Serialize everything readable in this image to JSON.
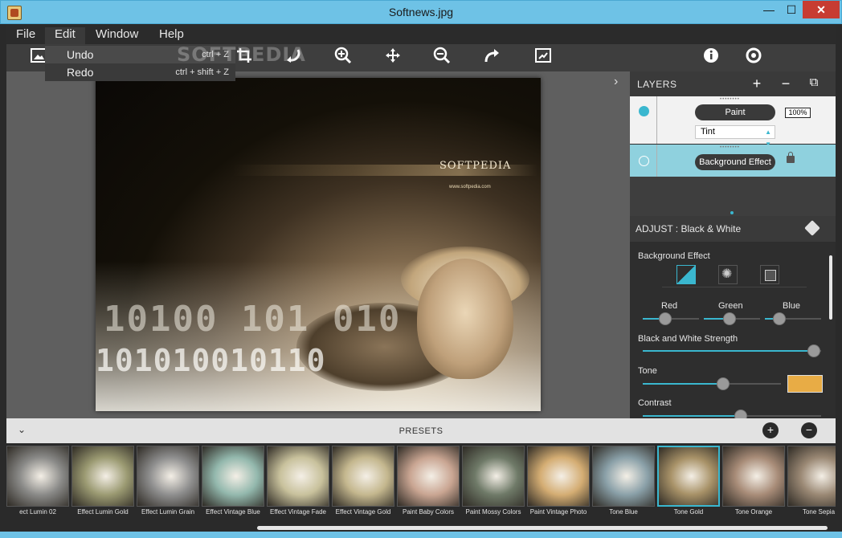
{
  "window": {
    "title": "Softnews.jpg",
    "minimize": "—",
    "maximize": "☐",
    "close": "✕"
  },
  "menu": {
    "file": "File",
    "edit": "Edit",
    "window": "Window",
    "help": "Help"
  },
  "edit_menu": {
    "undo": {
      "label": "Undo",
      "shortcut": "ctrl + Z"
    },
    "redo": {
      "label": "Redo",
      "shortcut": "ctrl + shift + Z"
    }
  },
  "watermark": "SOFTPEDIA",
  "photo": {
    "logo_text": "SOFTPEDIA",
    "url_text": "www.softpedia.com"
  },
  "layers": {
    "title": "LAYERS",
    "add": "+",
    "remove": "−",
    "duplicate": "⧉",
    "items": [
      {
        "name": "Paint",
        "opacity": "100%",
        "blend": "Tint"
      },
      {
        "name": "Background Effect"
      }
    ]
  },
  "adjust": {
    "title": "ADJUST : Black & White",
    "background_effect_label": "Background Effect",
    "red": "Red",
    "green": "Green",
    "blue": "Blue",
    "strength_label": "Black and White Strength",
    "tone_label": "Tone",
    "contrast_label": "Contrast",
    "tone_color": "#e8ac45",
    "accent_color": "#3ab7cf",
    "sliders": {
      "red": 0.4,
      "green": 0.45,
      "blue": 0.25,
      "strength": 0.96,
      "tone": 0.58,
      "contrast": 0.55
    }
  },
  "presets": {
    "title": "PRESETS",
    "items": [
      {
        "label": "ect Lumin 02",
        "tint": "#8a8a88"
      },
      {
        "label": "Effect Lumin Gold",
        "tint": "#9b9a72"
      },
      {
        "label": "Effect Lumin Grain",
        "tint": "#8e8e8e"
      },
      {
        "label": "Effect Vintage Blue",
        "tint": "#93b8ad"
      },
      {
        "label": "Effect Vintage Fade",
        "tint": "#c8c19c"
      },
      {
        "label": "Effect Vintage Gold",
        "tint": "#c4b78e"
      },
      {
        "label": "Paint Baby Colors",
        "tint": "#c9a592"
      },
      {
        "label": "Paint Mossy Colors",
        "tint": "#6f7a68"
      },
      {
        "label": "Paint Vintage Photo",
        "tint": "#d4ad73"
      },
      {
        "label": "Tone Blue",
        "tint": "#8aa0a8"
      },
      {
        "label": "Tone Gold",
        "tint": "#a89268",
        "selected": true
      },
      {
        "label": "Tone Orange",
        "tint": "#a88c78"
      },
      {
        "label": "Tone Sepia",
        "tint": "#9a8874"
      }
    ]
  }
}
